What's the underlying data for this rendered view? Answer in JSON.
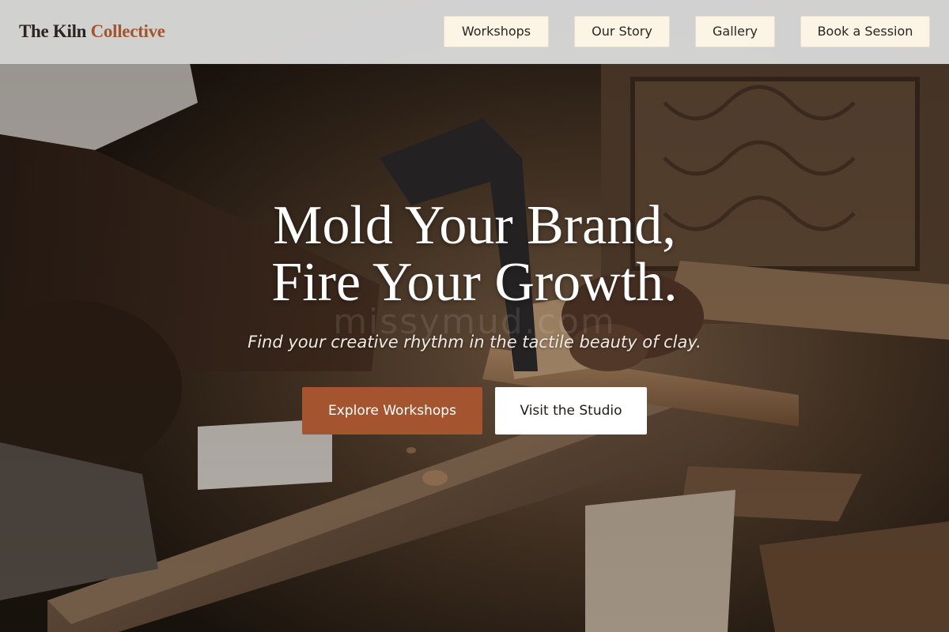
{
  "brand": {
    "part1": "The Kiln",
    "part2": "Collective"
  },
  "nav": {
    "workshops": "Workshops",
    "our_story": "Our Story",
    "gallery": "Gallery",
    "book_session": "Book a Session"
  },
  "hero": {
    "title_line1": "Mold Your Brand,",
    "title_line2": "Fire Your Growth.",
    "watermark": "missymud.com",
    "subtitle": "Find your creative rhythm in the tactile beauty of clay.",
    "cta_primary": "Explore Workshops",
    "cta_secondary": "Visit the Studio"
  },
  "colors": {
    "accent": "#a4552f",
    "nav_button_bg": "#fcf5e6",
    "header_bg": "#e0e0e0",
    "hero_text": "#ffffff"
  }
}
